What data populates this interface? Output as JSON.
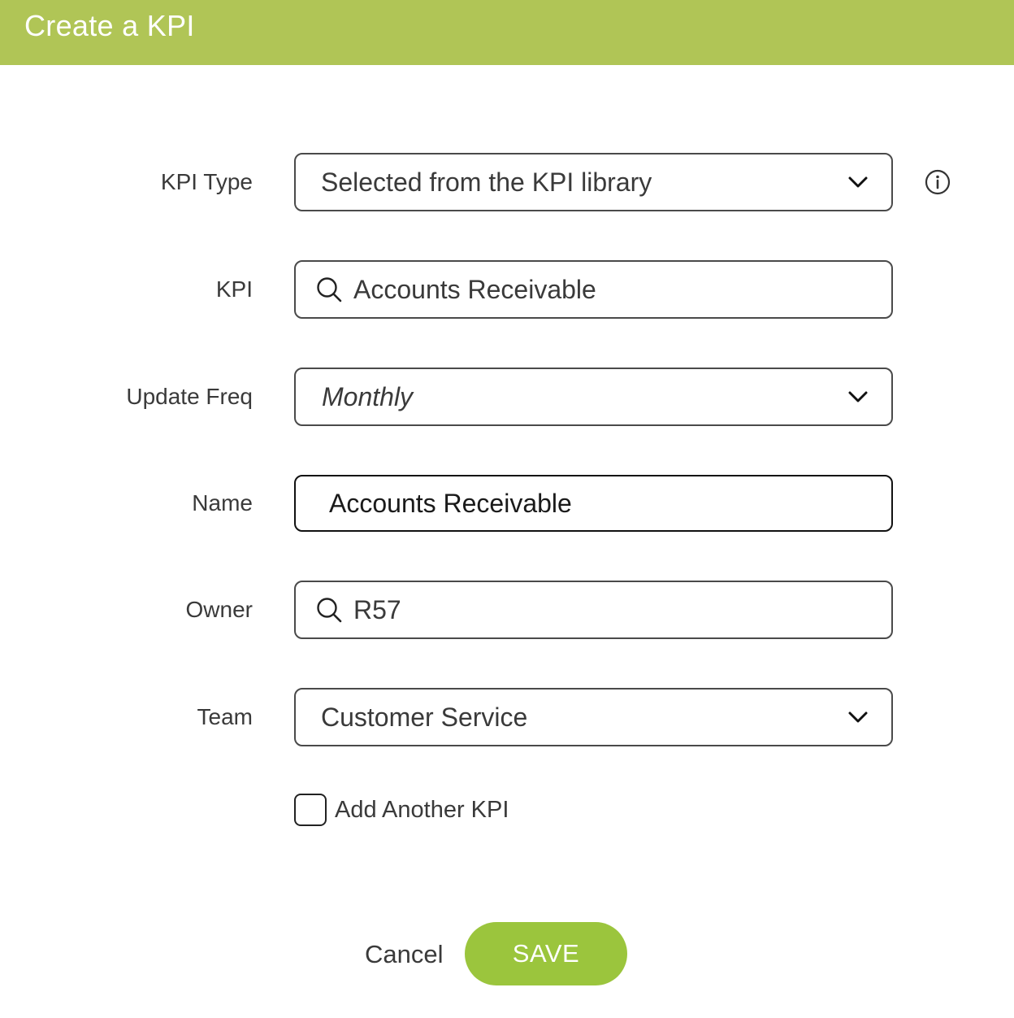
{
  "dialog": {
    "title": "Create a KPI"
  },
  "colors": {
    "header": "#b0c556",
    "save_button": "#9bc53d"
  },
  "form": {
    "kpi_type": {
      "label": "KPI Type",
      "value": "Selected from the KPI library",
      "icon": "chevron-down-icon"
    },
    "kpi": {
      "label": "KPI",
      "value": "Accounts Receivable",
      "icon": "search-icon"
    },
    "update_freq": {
      "label": "Update Freq",
      "value": "Monthly",
      "icon": "chevron-down-icon"
    },
    "name": {
      "label": "Name",
      "value": "Accounts Receivable"
    },
    "owner": {
      "label": "Owner",
      "value": "R57",
      "icon": "search-icon"
    },
    "team": {
      "label": "Team",
      "value": "Customer Service",
      "icon": "chevron-down-icon"
    },
    "add_another": {
      "label": "Add Another KPI",
      "checked": false
    }
  },
  "info_icon": "info-icon",
  "actions": {
    "cancel_label": "Cancel",
    "save_label": "SAVE"
  }
}
